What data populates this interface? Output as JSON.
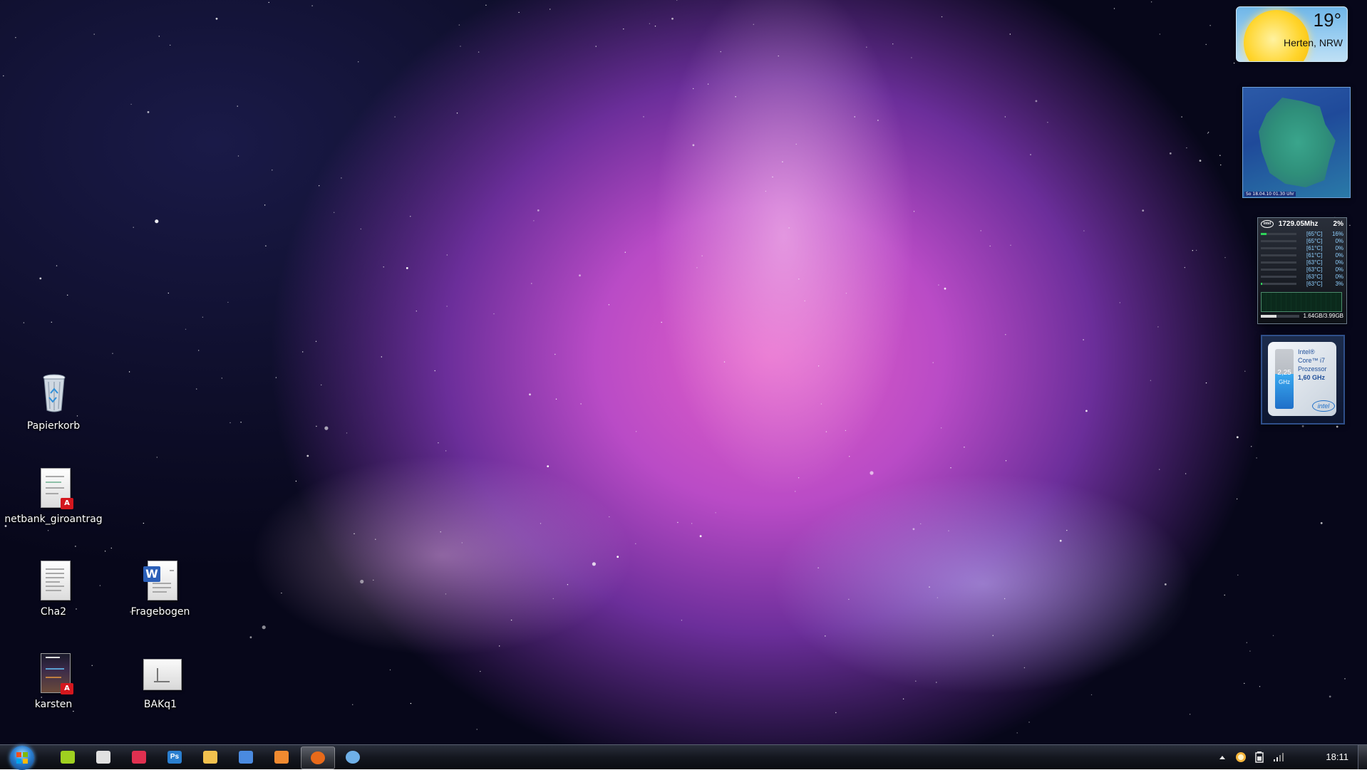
{
  "desktop": {
    "icons": [
      {
        "label": "Papierkorb",
        "kind": "recycle-bin-icon"
      },
      {
        "label": "netbank_giroantrag",
        "kind": "pdf-file-icon"
      },
      {
        "label": "Cha2",
        "kind": "text-document-icon"
      },
      {
        "label": "Fragebogen",
        "kind": "word-document-icon"
      },
      {
        "label": "karsten",
        "kind": "pdf-file-icon"
      },
      {
        "label": "BAKq1",
        "kind": "image-file-icon"
      }
    ]
  },
  "gadgets": {
    "weather": {
      "temperature": "19°",
      "location": "Herten, NRW"
    },
    "radar": {
      "timestamp": "So 18.04.10 01.30 Uhr"
    },
    "cpu_meter": {
      "frequency": "1729.05Mhz",
      "total_load": "2%",
      "cores": [
        {
          "temp": "[65°C]",
          "load": "16%",
          "fill": 0.16
        },
        {
          "temp": "[65°C]",
          "load": "0%",
          "fill": 0.0
        },
        {
          "temp": "[61°C]",
          "load": "0%",
          "fill": 0.0
        },
        {
          "temp": "[61°C]",
          "load": "0%",
          "fill": 0.0
        },
        {
          "temp": "[63°C]",
          "load": "0%",
          "fill": 0.0
        },
        {
          "temp": "[63°C]",
          "load": "0%",
          "fill": 0.0
        },
        {
          "temp": "[63°C]",
          "load": "0%",
          "fill": 0.0
        },
        {
          "temp": "[63°C]",
          "load": "3%",
          "fill": 0.03
        }
      ],
      "memory": "1.64GB/3.99GB",
      "memory_fill": 0.41
    },
    "intel_turbo": {
      "speed": "2,25",
      "speed_unit": "GHz",
      "level": 0.58,
      "line1": "Intel®",
      "line2": "Core™ i7",
      "line3": "Prozessor",
      "line4": "1,60 GHz",
      "logo": "intel"
    }
  },
  "taskbar": {
    "apps": [
      {
        "name": "android-app-icon",
        "color": "#9fd020"
      },
      {
        "name": "sync-app-icon",
        "color": "#e0e0e0"
      },
      {
        "name": "app-arrow-icon",
        "color": "#e03050"
      },
      {
        "name": "photoshop-icon",
        "color": "#2a7fd0",
        "text": "Ps"
      },
      {
        "name": "folder-icon",
        "color": "#f2c14e"
      },
      {
        "name": "save-app-icon",
        "color": "#4a8ae0"
      },
      {
        "name": "network-app-icon",
        "color": "#f08a30"
      },
      {
        "name": "firefox-icon",
        "color": "#e86a1a",
        "active": true
      },
      {
        "name": "globe-app-icon",
        "color": "#6fb0e8"
      }
    ],
    "clock": "18:11"
  },
  "colors": {
    "accent": "#e35ec8",
    "taskbar": "#14171f"
  }
}
